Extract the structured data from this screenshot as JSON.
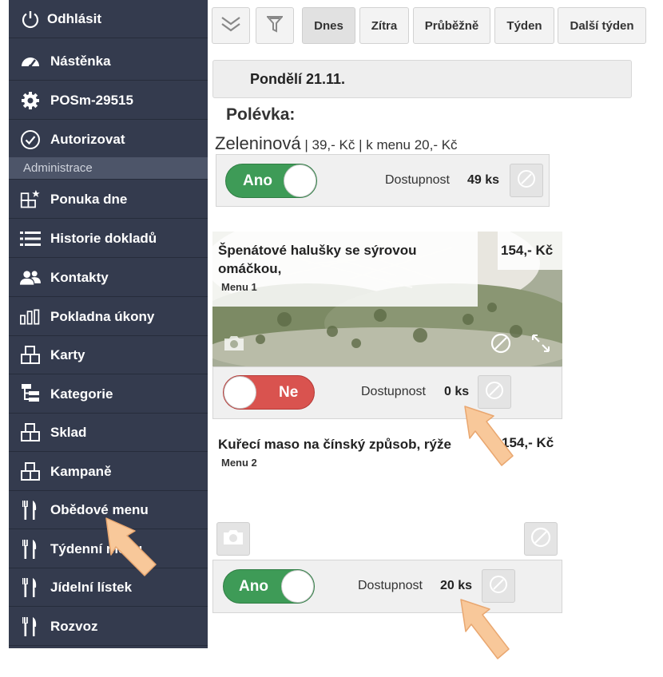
{
  "sidebar": {
    "items": [
      {
        "label": "Odhlásit",
        "icon": "power-icon"
      },
      {
        "label": "Nástěnka",
        "icon": "dashboard-icon"
      },
      {
        "label": "POSm-29515",
        "icon": "gear-icon"
      },
      {
        "label": "Autorizovat",
        "icon": "check-circle-icon"
      }
    ],
    "section_label": "Administrace",
    "admin_items": [
      {
        "label": "Ponuka dne",
        "icon": "boxes-star-icon"
      },
      {
        "label": "Historie dokladů",
        "icon": "list-icon"
      },
      {
        "label": "Kontakty",
        "icon": "users-icon"
      },
      {
        "label": "Pokladna úkony",
        "icon": "bar-chart-icon"
      },
      {
        "label": "Karty",
        "icon": "boxes-icon"
      },
      {
        "label": "Kategorie",
        "icon": "tree-icon"
      },
      {
        "label": "Sklad",
        "icon": "boxes-icon"
      },
      {
        "label": "Kampaně",
        "icon": "boxes-icon"
      },
      {
        "label": "Obědové menu",
        "icon": "cutlery-icon"
      },
      {
        "label": "Týdenní menu",
        "icon": "cutlery-icon"
      },
      {
        "label": "Jídelní lístek",
        "icon": "cutlery-icon"
      },
      {
        "label": "Rozvoz",
        "icon": "cutlery-icon"
      }
    ]
  },
  "toolbar": {
    "icons": [
      "chevrons-down-icon",
      "filter-icon"
    ],
    "tabs": [
      "Dnes",
      "Zítra",
      "Průběžně",
      "Týden",
      "Další týden"
    ],
    "active_tab": "Dnes"
  },
  "day": {
    "title": "Pondělí 21.11."
  },
  "soup": {
    "section_title": "Polévka:",
    "name": "Zeleninová",
    "meta": " | 39,- Kč | k menu 20,- Kč",
    "toggle_label": "Ano",
    "availability_label": "Dostupnost",
    "availability_value": "49 ks"
  },
  "dishes": [
    {
      "name_line1": "Špenátové halušky se sýrovou",
      "name_line2": "omáčkou,",
      "menu": "Menu 1",
      "price": "154,- Kč",
      "toggle_label": "Ne",
      "toggle_on": false,
      "availability_label": "Dostupnost",
      "availability_value": "0 ks"
    },
    {
      "name_line1": "Kuřecí maso na čínský způsob, rýže",
      "menu": "Menu 2",
      "price": "154,- Kč",
      "toggle_label": "Ano",
      "toggle_on": true,
      "availability_label": "Dostupnost",
      "availability_value": "20 ks"
    }
  ],
  "colors": {
    "sidebar_bg": "#343b4e",
    "toggle_on": "#3e9b57",
    "toggle_off": "#d9534f",
    "arrow": "#f8c89a"
  }
}
